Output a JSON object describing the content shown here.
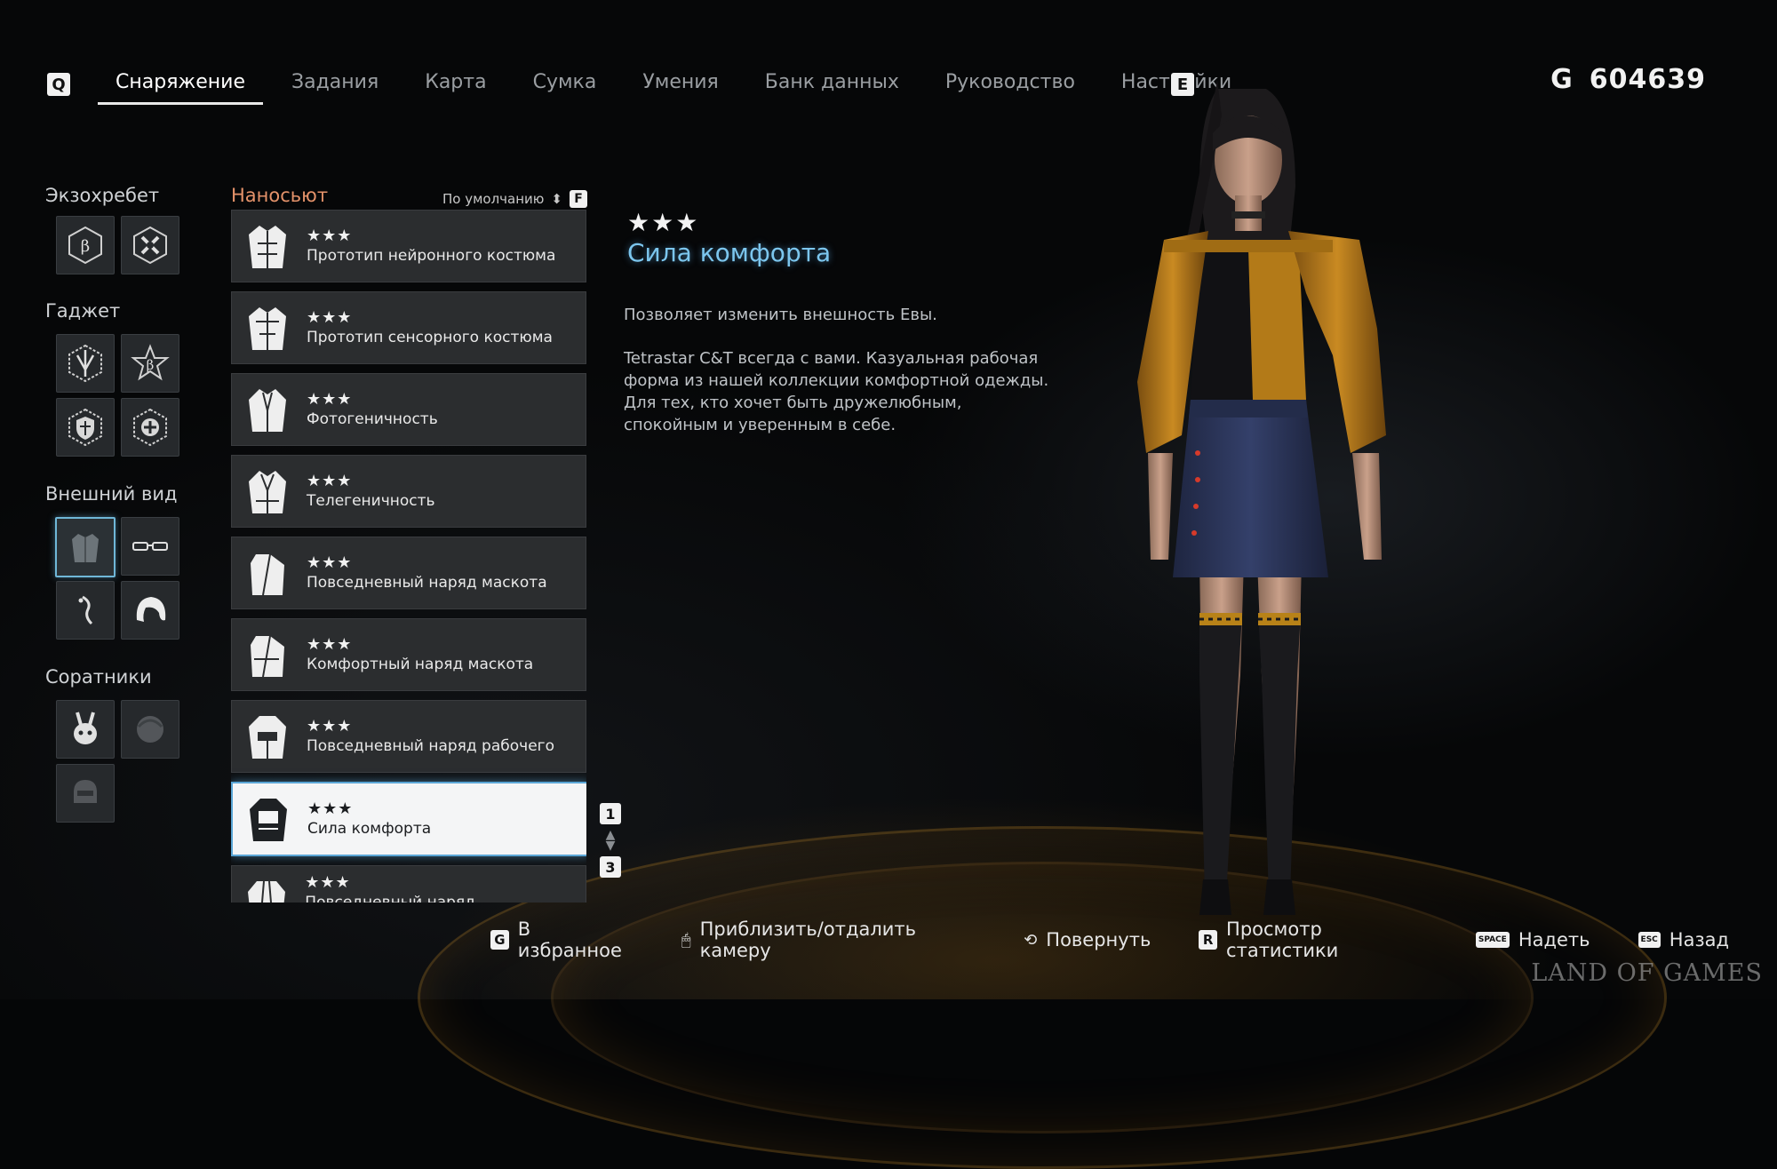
{
  "nav": {
    "left_key": "Q",
    "right_key": "E",
    "tabs": [
      {
        "label": "Снаряжение",
        "active": true
      },
      {
        "label": "Задания",
        "active": false
      },
      {
        "label": "Карта",
        "active": false
      },
      {
        "label": "Сумка",
        "active": false
      },
      {
        "label": "Умения",
        "active": false
      },
      {
        "label": "Банк данных",
        "active": false
      },
      {
        "label": "Руководство",
        "active": false
      },
      {
        "label": "Настройки",
        "active": false
      }
    ]
  },
  "currency": {
    "symbol": "G",
    "amount": "604639"
  },
  "sidebar": {
    "exospine": "Экзохребет",
    "gadget": "Гаджет",
    "appearance": "Внешний вид",
    "companions": "Соратники"
  },
  "list": {
    "title": "Наносьют",
    "sort_label": "По умолчанию",
    "sort_key": "F",
    "items": [
      {
        "stars": "★★★",
        "name": "Прототип нейронного костюма"
      },
      {
        "stars": "★★★",
        "name": "Прототип сенсорного костюма"
      },
      {
        "stars": "★★★",
        "name": "Фотогеничность"
      },
      {
        "stars": "★★★",
        "name": "Телегеничность"
      },
      {
        "stars": "★★★",
        "name": "Повседневный наряд маскота"
      },
      {
        "stars": "★★★",
        "name": "Комфортный наряд маскота"
      },
      {
        "stars": "★★★",
        "name": "Повседневный наряд рабочего"
      },
      {
        "stars": "★★★",
        "name": "Сила комфорта",
        "selected": true
      },
      {
        "stars": "★★★",
        "name": "Повседневный наряд мотоциклиста"
      }
    ],
    "pager_top": "1",
    "pager_bottom": "3"
  },
  "detail": {
    "stars": "★★★",
    "title": "Сила комфорта",
    "desc1": "Позволяет изменить внешность Евы.",
    "desc2": "Tetrastar C&T всегда с вами. Казуальная рабочая форма из нашей коллекции комфортной одежды. Для тех, кто хочет быть дружелюбным, спокойным и уверенным в себе."
  },
  "hints": {
    "favorite_key": "G",
    "favorite": "В избранное",
    "zoom": "Приблизить/отдалить камеру",
    "rotate": "Повернуть",
    "stats_key": "R",
    "stats": "Просмотр статистики",
    "equip_key": "SPACE",
    "equip": "Надеть",
    "back_key": "ESC",
    "back": "Назад"
  },
  "watermark": "LAND OF GAMES",
  "colors": {
    "accent": "#7cc6ee",
    "list_title": "#e4926a",
    "selection_border": "#5aa6d6"
  }
}
